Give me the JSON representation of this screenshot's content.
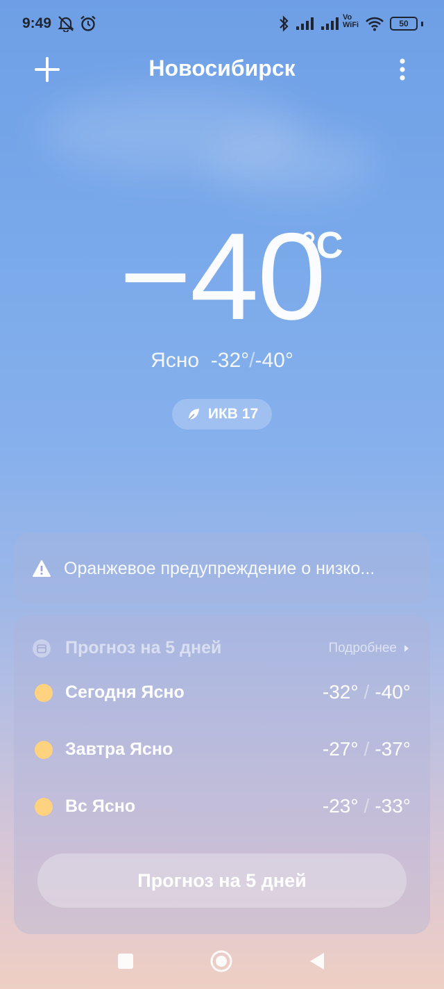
{
  "status_bar": {
    "time": "9:49",
    "vowifi_top": "Vo",
    "vowifi_bottom": "WiFi",
    "battery": "50"
  },
  "header": {
    "city": "Новосибирск"
  },
  "current": {
    "temperature": "−40",
    "unit": "°C",
    "condition": "Ясно",
    "high": "-32°",
    "low": "-40°",
    "aqi_label": "ИКВ 17"
  },
  "warning": {
    "text": "Оранжевое предупреждение о низко..."
  },
  "forecast": {
    "title": "Прогноз на 5 дней",
    "more_label": "Подробнее",
    "days": [
      {
        "label": "Сегодня  Ясно",
        "high": "-32°",
        "low": "-40°"
      },
      {
        "label": "Завтра  Ясно",
        "high": "-27°",
        "low": "-37°"
      },
      {
        "label": "Вс  Ясно",
        "high": "-23°",
        "low": "-33°"
      }
    ],
    "button_label": "Прогноз на 5 дней"
  },
  "colors": {
    "sun": "#fed27f",
    "sky_top": "#6e9fe6",
    "sky_bottom": "#efcfc3"
  }
}
